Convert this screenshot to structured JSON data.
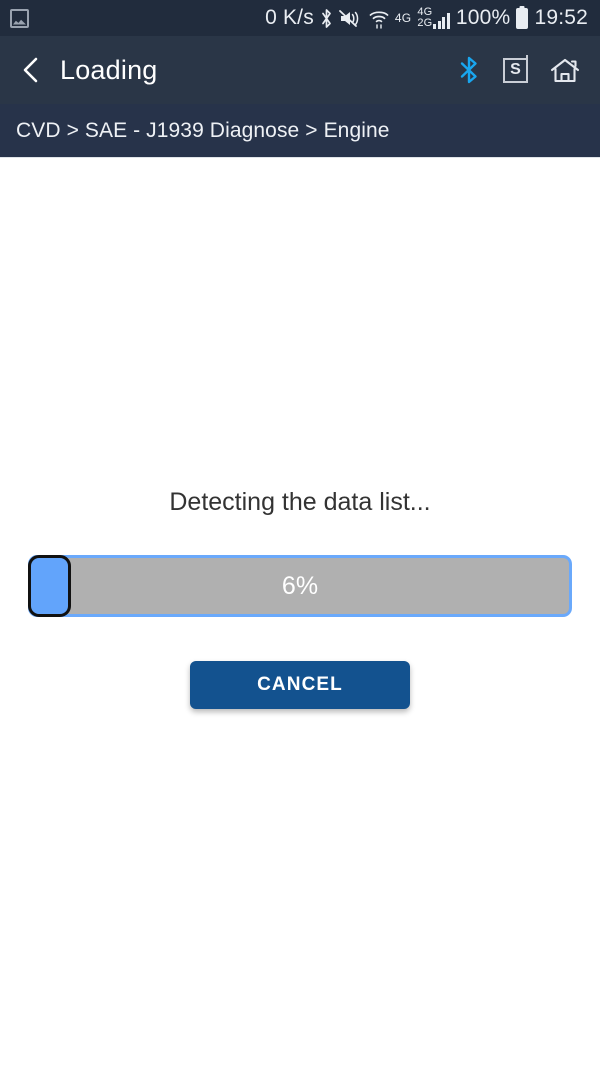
{
  "status_bar": {
    "notification_icon": "gallery-icon",
    "network_speed": "0 K/s",
    "bluetooth_icon": "bluetooth-icon",
    "mute_icon": "volume-mute-vibrate-icon",
    "wifi_icon": "wifi-icon",
    "network_type": "4G",
    "sim_labels": [
      "4G",
      "2G"
    ],
    "signal_icon": "signal-bars-icon",
    "battery_percent": "100%",
    "battery_icon": "battery-full-icon",
    "clock": "19:52"
  },
  "header": {
    "back_icon": "chevron-left-icon",
    "title": "Loading",
    "actions": [
      {
        "name": "bluetooth-icon",
        "label": "Bluetooth"
      },
      {
        "name": "screenshot-icon",
        "label": "S"
      },
      {
        "name": "home-icon",
        "label": "Home"
      }
    ]
  },
  "breadcrumb": {
    "text": "CVD > SAE - J1939 Diagnose > Engine",
    "segments": [
      "CVD",
      "SAE - J1939 Diagnose",
      "Engine"
    ],
    "separator": ">"
  },
  "main": {
    "loading_message": "Detecting the data list...",
    "progress": {
      "percent_label": "6%",
      "value": 6,
      "min": 0,
      "max": 100,
      "fill_color": "#62a4fb",
      "track_color": "#b0b0b0",
      "border_color": "#6aa9fb"
    },
    "cancel_label": "CANCEL"
  },
  "colors": {
    "status_bar_bg": "#212c3d",
    "header_bg": "#2a3647",
    "breadcrumb_bg": "#27334a",
    "content_bg": "#ffffff",
    "accent_blue": "#13528f",
    "bluetooth_blue": "#19a6ef"
  }
}
